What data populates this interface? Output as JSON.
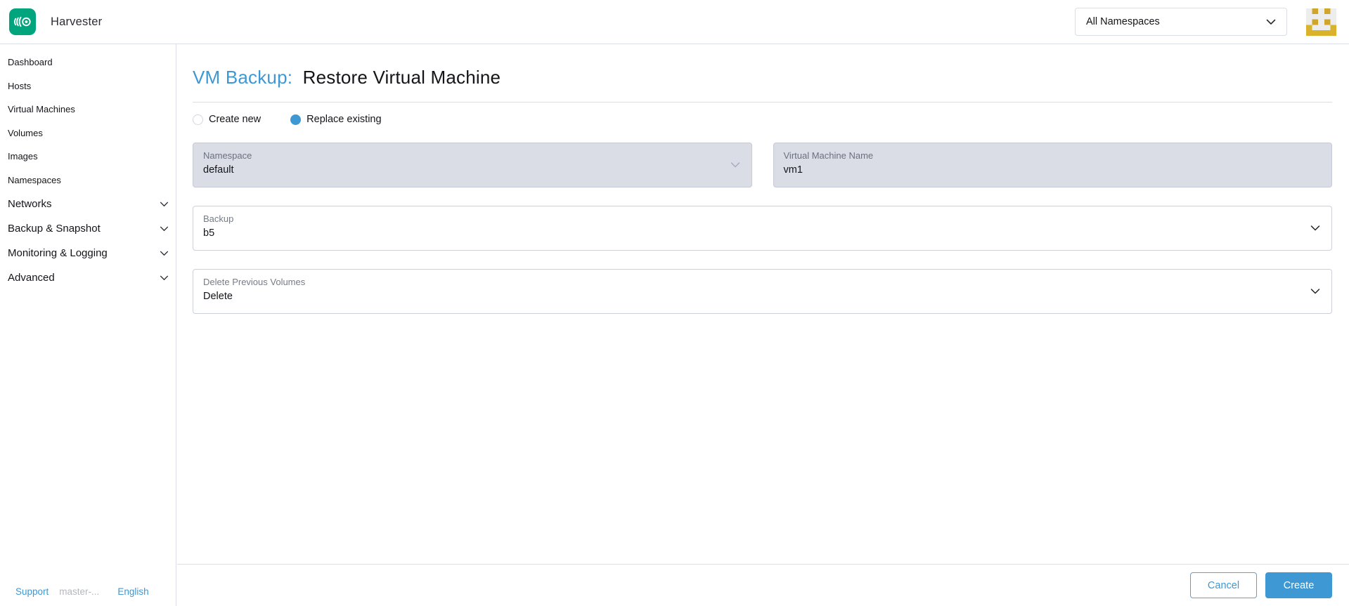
{
  "header": {
    "app_name": "Harvester",
    "namespace_filter_value": "All Namespaces"
  },
  "sidebar": {
    "items": [
      "Dashboard",
      "Hosts",
      "Virtual Machines",
      "Volumes",
      "Images",
      "Namespaces"
    ],
    "groups": [
      "Networks",
      "Backup & Snapshot",
      "Monitoring & Logging",
      "Advanced"
    ],
    "footer": {
      "support_label": "Support",
      "version_label": "master-...",
      "language_label": "English"
    }
  },
  "page": {
    "title_prefix": "VM Backup:",
    "title": "Restore Virtual Machine",
    "radio_options": [
      {
        "label": "Create new",
        "selected": false
      },
      {
        "label": "Replace existing",
        "selected": true
      }
    ],
    "fields": {
      "namespace": {
        "label": "Namespace",
        "value": "default",
        "disabled": true
      },
      "vm_name": {
        "label": "Virtual Machine Name",
        "value": "vm1",
        "disabled": true
      },
      "backup": {
        "label": "Backup",
        "value": "b5",
        "disabled": false
      },
      "delete_previous_volumes": {
        "label": "Delete Previous Volumes",
        "value": "Delete",
        "disabled": false
      }
    },
    "actions": {
      "cancel_label": "Cancel",
      "create_label": "Create"
    }
  },
  "colors": {
    "primary_blue": "#3d98d3",
    "logo_green": "#00a57e",
    "avatar_gold_dark": "#cfa62b",
    "avatar_gold_light": "#d9b32b",
    "disabled_input_bg": "#dadde6",
    "border_gray": "#dcdee7",
    "label_gray": "#767b87",
    "text_dark": "#141419",
    "muted_gray": "#b5b7bf"
  }
}
